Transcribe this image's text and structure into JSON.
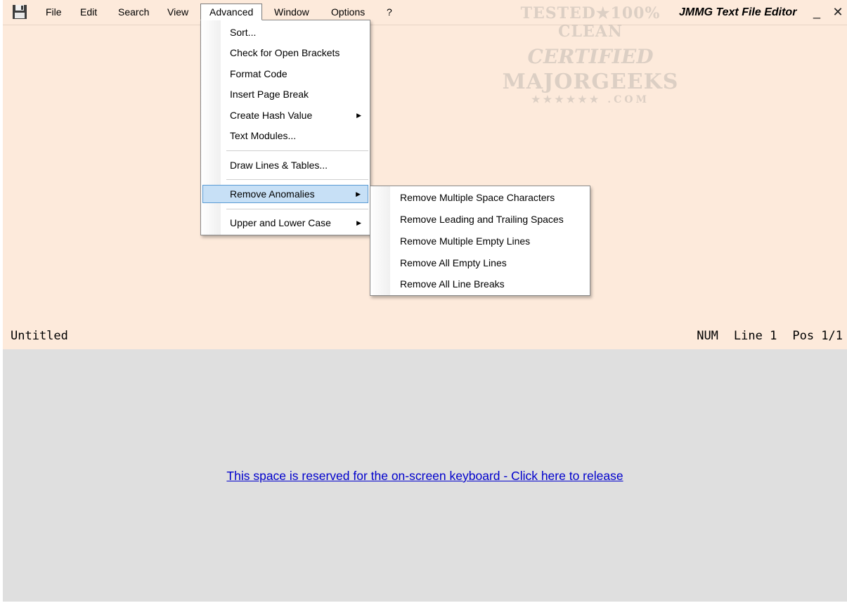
{
  "window": {
    "title": "JMMG Text File Editor",
    "minimize_glyph": "_",
    "close_glyph": "✕"
  },
  "menubar": {
    "save_icon": "floppy-disk-icon",
    "items": [
      "File",
      "Edit",
      "Search",
      "View",
      "Advanced",
      "Window",
      "Options",
      "?"
    ],
    "active": "Advanced"
  },
  "watermark": {
    "line1": "TESTED★100% CLEAN",
    "line2": "CERTIFIED",
    "line3": "MAJORGEEKS",
    "line4": "★★★★★★ .COM"
  },
  "advanced_menu": {
    "items": [
      {
        "label": "Sort...",
        "submenu": false
      },
      {
        "label": "Check for Open Brackets",
        "submenu": false
      },
      {
        "label": "Format Code",
        "submenu": false
      },
      {
        "label": "Insert Page Break",
        "submenu": false
      },
      {
        "label": "Create Hash Value",
        "submenu": true
      },
      {
        "label": "Text Modules...",
        "submenu": false
      },
      {
        "label": "Draw Lines & Tables...",
        "submenu": false
      },
      {
        "label": "Remove Anomalies",
        "submenu": true,
        "highlighted": true
      },
      {
        "label": "Upper and Lower Case",
        "submenu": true
      }
    ]
  },
  "remove_anomalies_submenu": {
    "items": [
      "Remove Multiple Space Characters",
      "Remove Leading and Trailing Spaces",
      "Remove Multiple Empty Lines",
      "Remove All Empty Lines",
      "Remove All Line Breaks"
    ]
  },
  "status": {
    "filename": "Untitled",
    "num": "NUM",
    "line": "Line 1",
    "pos": "Pos 1/1"
  },
  "keyboard_area": {
    "link_text": "This space is reserved for the on-screen keyboard - Click here to release"
  },
  "colors": {
    "editor_bg": "#fdeadb",
    "keyboard_bg": "#dfdfdf",
    "highlight": "#c7e0f6",
    "link": "#0000cc"
  }
}
